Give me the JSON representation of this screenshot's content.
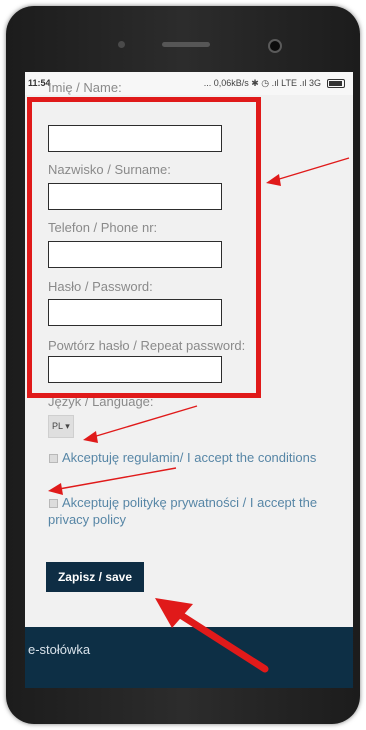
{
  "status_bar": {
    "time": "11:54",
    "indicators": "... 0,06kB/s ✱ ◷ .ıl LTE .ıl 3G"
  },
  "form": {
    "fields": [
      {
        "label": "Imię / Name:",
        "value": ""
      },
      {
        "label": "Nazwisko / Surname:",
        "value": ""
      },
      {
        "label": "Telefon / Phone nr:",
        "value": ""
      },
      {
        "label": "Hasło / Password:",
        "value": ""
      },
      {
        "label": "Powtórz hasło / Repeat password:",
        "value": ""
      }
    ],
    "language": {
      "label": "Język / Language:",
      "selected": "PL"
    },
    "checkboxes": [
      {
        "label": "Akceptuję regulamin/ I accept the conditions",
        "checked": false
      },
      {
        "label": "Akceptuję politykę prywatności / I accept the privacy policy",
        "checked": false
      }
    ],
    "save_label": "Zapisz / save"
  },
  "footer": {
    "brand": "e-stołówka"
  },
  "annotation_color": "#e01a1a",
  "footer_color": "#0d2f45",
  "link_color": "#5786a6"
}
